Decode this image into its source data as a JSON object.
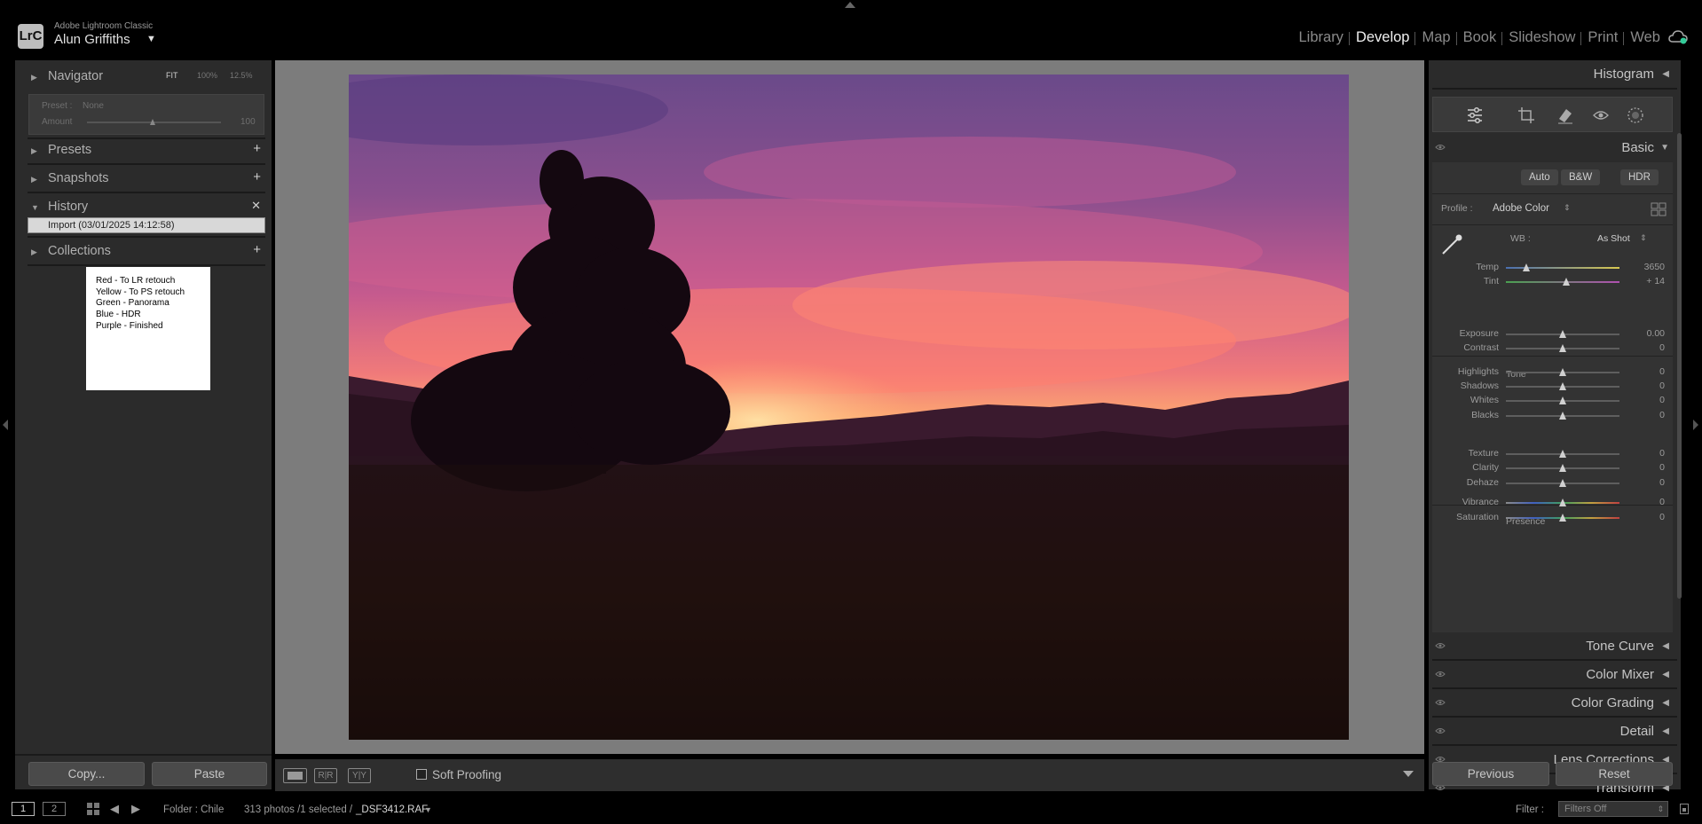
{
  "app": {
    "logo": "LrC",
    "name": "Adobe Lightroom Classic",
    "user": "Alun Griffiths"
  },
  "modules": [
    "Library",
    "Develop",
    "Map",
    "Book",
    "Slideshow",
    "Print",
    "Web"
  ],
  "active_module": "Develop",
  "left_panel": {
    "navigator": {
      "title": "Navigator",
      "zoom_fit": "FIT",
      "zoom_100": "100%",
      "zoom_125": "12.5%"
    },
    "preset_preview": {
      "preset_label": "Preset :",
      "preset_value": "None",
      "amount_label": "Amount",
      "amount_value": "100"
    },
    "presets": {
      "title": "Presets"
    },
    "snapshots": {
      "title": "Snapshots"
    },
    "history": {
      "title": "History",
      "items": [
        "Import (03/01/2025 14:12:58)"
      ]
    },
    "collections": {
      "title": "Collections"
    },
    "note_lines": [
      "Red - To LR retouch",
      "Yellow - To PS retouch",
      "Green - Panorama",
      "Blue - HDR",
      "Purple - Finished"
    ],
    "copy_button": "Copy...",
    "paste_button": "Paste"
  },
  "toolbar": {
    "soft_proofing_label": "Soft Proofing",
    "soft_proofing_checked": false
  },
  "right_panel": {
    "histogram": {
      "title": "Histogram"
    },
    "basic": {
      "title": "Basic",
      "auto_button": "Auto",
      "bw_button": "B&W",
      "hdr_button": "HDR",
      "profile_label": "Profile :",
      "profile_value": "Adobe Color",
      "wb_label": "WB :",
      "wb_value": "As Shot",
      "tone_label": "Tone",
      "presence_label": "Presence",
      "sliders": [
        {
          "label": "Temp",
          "value": "3650",
          "position": 0.18
        },
        {
          "label": "Tint",
          "value": "+ 14",
          "position": 0.53
        },
        {
          "label": "Exposure",
          "value": "0.00",
          "position": 0.5
        },
        {
          "label": "Contrast",
          "value": "0",
          "position": 0.5
        },
        {
          "label": "Highlights",
          "value": "0",
          "position": 0.5
        },
        {
          "label": "Shadows",
          "value": "0",
          "position": 0.5
        },
        {
          "label": "Whites",
          "value": "0",
          "position": 0.5
        },
        {
          "label": "Blacks",
          "value": "0",
          "position": 0.5
        },
        {
          "label": "Texture",
          "value": "0",
          "position": 0.5
        },
        {
          "label": "Clarity",
          "value": "0",
          "position": 0.5
        },
        {
          "label": "Dehaze",
          "value": "0",
          "position": 0.5
        },
        {
          "label": "Vibrance",
          "value": "0",
          "position": 0.5
        },
        {
          "label": "Saturation",
          "value": "0",
          "position": 0.5
        }
      ]
    },
    "collapsed_panels": [
      "Tone Curve",
      "Color Mixer",
      "Color Grading",
      "Detail",
      "Lens Corrections",
      "Transform"
    ],
    "previous_button": "Previous",
    "reset_button": "Reset"
  },
  "bottom_bar": {
    "screen1": "1",
    "screen2": "2",
    "folder": "Folder : Chile",
    "count": "313 photos /1 selected /",
    "filename": "_DSF3412.RAF",
    "filter_label": "Filter :",
    "filter_value": "Filters Off"
  }
}
